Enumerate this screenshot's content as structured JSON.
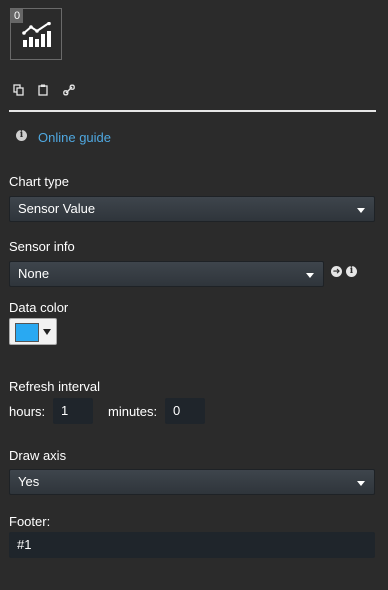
{
  "widget": {
    "badge": "0",
    "icon": "chart-icon"
  },
  "toolbar": {
    "icons": [
      "copy-icon",
      "paste-icon",
      "link-icon"
    ]
  },
  "guide": {
    "label": "Online guide",
    "icon": "info-icon"
  },
  "chart_type": {
    "label": "Chart type",
    "value": "Sensor Value"
  },
  "sensor_info": {
    "label": "Sensor info",
    "value": "None"
  },
  "data_color": {
    "label": "Data color",
    "value": "#29a9f2"
  },
  "refresh": {
    "label": "Refresh interval",
    "hours_label": "hours:",
    "hours_value": "1",
    "minutes_label": "minutes:",
    "minutes_value": "0"
  },
  "draw_axis": {
    "label": "Draw axis",
    "value": "Yes"
  },
  "footer": {
    "label": "Footer:",
    "value": "#1"
  },
  "colors": {
    "accent": "#4fa8e0",
    "background": "#2b2b2b",
    "input_bg": "#1f252b"
  }
}
